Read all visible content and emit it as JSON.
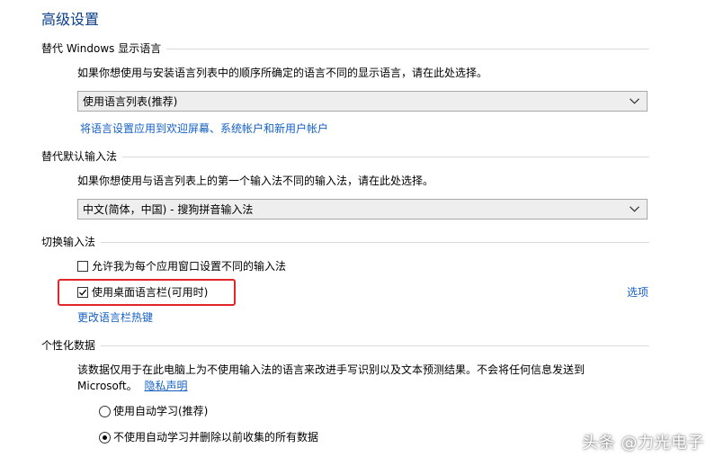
{
  "page_title": "高级设置",
  "sections": {
    "override_display_language": {
      "header": "替代 Windows 显示语言",
      "description": "如果你想使用与安装语言列表中的顺序所确定的语言不同的显示语言，请在此处选择。",
      "select_value": "使用语言列表(推荐)",
      "link": "将语言设置应用到欢迎屏幕、系统帐户和新用户帐户"
    },
    "override_default_input": {
      "header": "替代默认输入法",
      "description": "如果你想使用与语言列表上的第一个输入法不同的输入法，请在此处选择。",
      "select_value": "中文(简体，中国) - 搜狗拼音输入法"
    },
    "switch_input": {
      "header": "切换输入法",
      "checkbox_per_app": {
        "label": "允许我为每个应用窗口设置不同的输入法",
        "checked": false
      },
      "checkbox_language_bar": {
        "label": "使用桌面语言栏(可用时)",
        "checked": true
      },
      "options_link": "选项",
      "hotkeys_link": "更改语言栏热键"
    },
    "personalization": {
      "header": "个性化数据",
      "description_line1": "该数据仅用于在此电脑上为不使用输入法的语言来改进手写识别以及文本预测结果。不会将任何信息发送到",
      "description_line2": "Microsoft。",
      "privacy_link": "隐私声明",
      "radio_auto": {
        "label": "使用自动学习(推荐)",
        "checked": false
      },
      "radio_no_auto": {
        "label": "不使用自动学习并删除以前收集的所有数据",
        "checked": true
      }
    }
  },
  "watermark": "头条 @力光电子",
  "colors": {
    "title": "#0a3d8a",
    "link": "#1560c5",
    "highlight": "#e0262a"
  }
}
